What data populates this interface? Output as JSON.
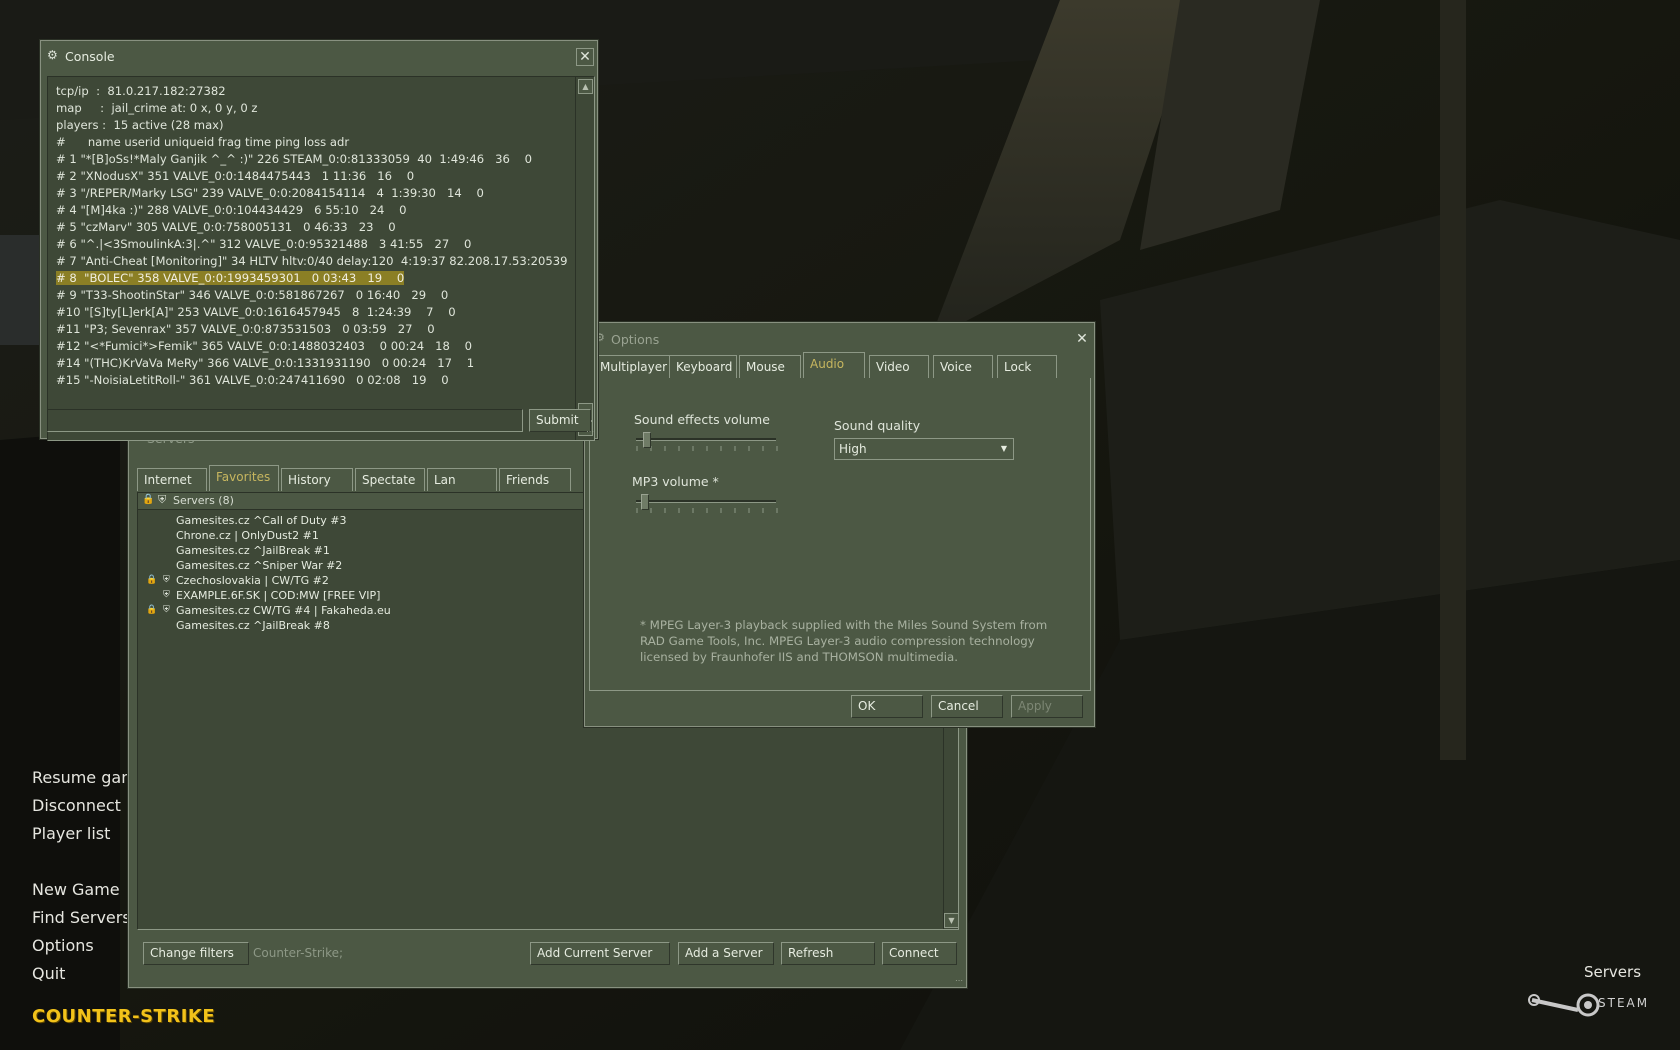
{
  "menu": {
    "items": [
      "Resume game",
      "Disconnect",
      "Player list",
      "New Game",
      "Find Servers",
      "Options",
      "Quit"
    ],
    "logo_text": "COUNTER-STRIKE"
  },
  "corner": {
    "servers_label": "Servers",
    "steam_label": "STEAM"
  },
  "console": {
    "title": "Console",
    "lines": [
      "tcp/ip  :  81.0.217.182:27382",
      "map     :  jail_crime at: 0 x, 0 y, 0 z",
      "players :  15 active (28 max)",
      "",
      "#      name userid uniqueid frag time ping loss adr",
      "# 1 \"*[B]oSs!*Maly Ganjik ^_^ :)\" 226 STEAM_0:0:81333059  40  1:49:46   36    0",
      "# 2 \"XNodusX\" 351 VALVE_0:0:1484475443   1 11:36   16    0",
      "# 3 \"/REPER/Marky LSG\" 239 VALVE_0:0:2084154114   4  1:39:30   14    0",
      "# 4 \"[M]4ka :)\" 288 VALVE_0:0:104434429   6 55:10   24    0",
      "# 5 \"czMarv\" 305 VALVE_0:0:758005131   0 46:33   23    0",
      "# 6 \"^.|<3SmoulinkA:3|.^\" 312 VALVE_0:0:95321488   3 41:55   27    0",
      "# 7 \"Anti-Cheat [Monitoring]\" 34 HLTV hltv:0/40 delay:120  4:19:37 82.208.17.53:20539",
      "# 8  \"BOLEC\" 358 VALVE_0:0:1993459301   0 03:43   19    0",
      "# 9 \"T33-ShootinStar\" 346 VALVE_0:0:581867267   0 16:40   29    0",
      "#10 \"[S]ty[L]erk[A]\" 253 VALVE_0:0:1616457945   8  1:24:39    7    0",
      "#11 \"P3; Sevenrax\" 357 VALVE_0:0:873531503   0 03:59   27    0",
      "#12 \"<*Fumici*>Femik\" 365 VALVE_0:0:1488032403    0 00:24   18    0",
      "#14 \"(THC)KrVaVa MeRy\" 366 VALVE_0:0:1331931190   0 00:24   17    1",
      "#15 \"-NoisiaLetitRoll-\" 361 VALVE_0:0:247411690   0 02:08   19    0"
    ],
    "highlighted_line": 12,
    "input_value": "",
    "submit_label": "Submit"
  },
  "servers": {
    "title": "Servers",
    "tabs": [
      "Internet",
      "Favorites",
      "History",
      "Spectate",
      "Lan",
      "Friends"
    ],
    "active_tab": 1,
    "list_header": "Servers (8)",
    "rows": [
      {
        "name": "Gamesites.cz ^Call of Duty #3",
        "lock": false,
        "shield": false
      },
      {
        "name": "Chrone.cz | OnlyDust2 #1",
        "lock": false,
        "shield": false
      },
      {
        "name": "Gamesites.cz ^JailBreak #1",
        "lock": false,
        "shield": false
      },
      {
        "name": "Gamesites.cz ^Sniper War #2",
        "lock": false,
        "shield": false
      },
      {
        "name": "Czechoslovakia | CW/TG #2",
        "lock": true,
        "shield": true
      },
      {
        "name": "EXAMPLE.6F.SK | COD:MW [FREE VIP]",
        "lock": false,
        "shield": true
      },
      {
        "name": "Gamesites.cz CW/TG #4 | Fakaheda.eu",
        "lock": true,
        "shield": true
      },
      {
        "name": "Gamesites.cz ^JailBreak #8",
        "lock": false,
        "shield": false
      }
    ],
    "buttons": {
      "change_filters": "Change filters",
      "filter_text": "Counter-Strike;",
      "add_current": "Add Current Server",
      "add_server": "Add a Server",
      "refresh": "Refresh",
      "connect": "Connect"
    }
  },
  "options": {
    "title": "Options",
    "tabs": [
      "Multiplayer",
      "Keyboard",
      "Mouse",
      "Audio",
      "Video",
      "Voice",
      "Lock"
    ],
    "active_tab": 3,
    "sound_effects_label": "Sound effects volume",
    "sound_effects_value": 0.05,
    "mp3_label": "MP3 volume *",
    "mp3_value": 0.04,
    "sound_quality_label": "Sound quality",
    "sound_quality_value": "High",
    "note_lines": [
      "* MPEG Layer-3 playback supplied with the Miles Sound System from",
      "RAD Game Tools, Inc. MPEG Layer-3 audio compression technology",
      "licensed by Fraunhofer IIS and THOMSON multimedia."
    ],
    "ok_label": "OK",
    "cancel_label": "Cancel",
    "apply_label": "Apply"
  },
  "colors": {
    "window_bg": "#4c5844",
    "active_tab_text": "#c7b65f",
    "highlight": "#8b7f25",
    "logo": "#f2c21a"
  }
}
